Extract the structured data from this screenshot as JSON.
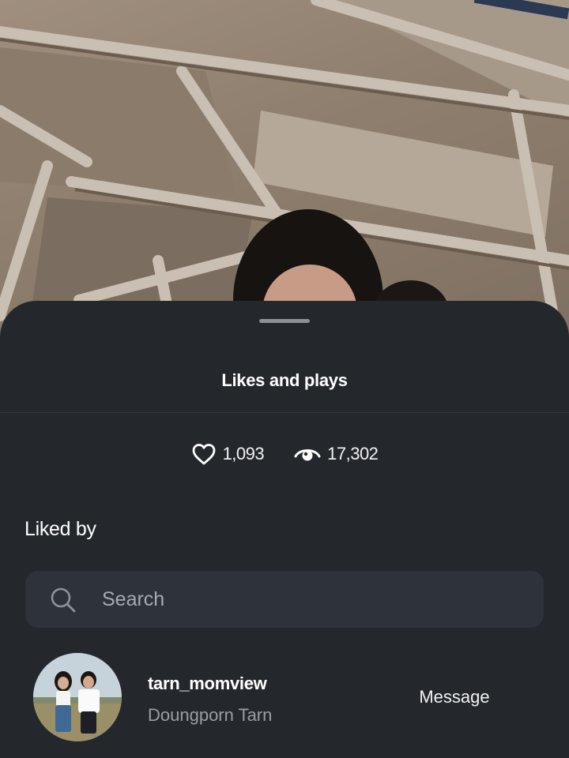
{
  "sheet": {
    "title": "Likes and plays",
    "stats": {
      "likes": "1,093",
      "plays": "17,302",
      "likes_icon": "heart-icon",
      "plays_icon": "eye-icon"
    },
    "liked_by_label": "Liked by",
    "search": {
      "placeholder": "Search",
      "value": "",
      "icon": "search-icon"
    },
    "users": [
      {
        "username": "tarn_momview",
        "full_name": "Doungporn Tarn",
        "action_label": "Message"
      }
    ]
  },
  "colors": {
    "sheet_background": "#24272c",
    "search_background": "#2e323a",
    "primary_text": "#ffffff",
    "secondary_text": "#9a9ea5"
  }
}
